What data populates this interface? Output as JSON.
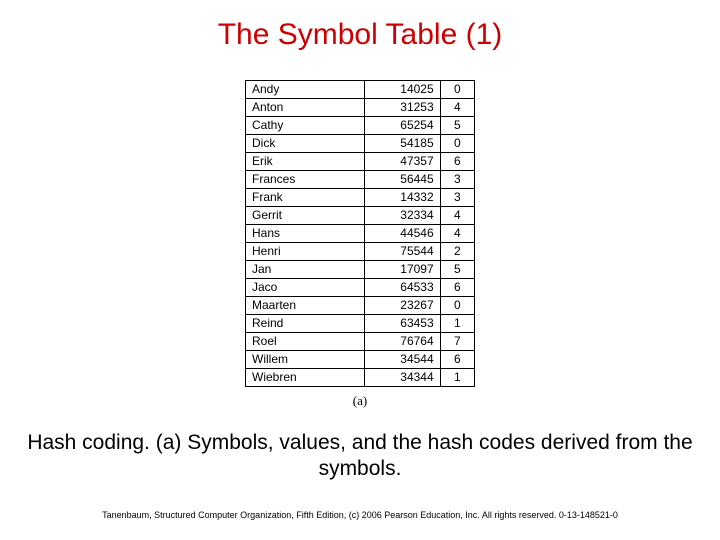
{
  "title": "The Symbol Table (1)",
  "table": {
    "rows": [
      {
        "name": "Andy",
        "value": "14025",
        "hash": "0"
      },
      {
        "name": "Anton",
        "value": "31253",
        "hash": "4"
      },
      {
        "name": "Cathy",
        "value": "65254",
        "hash": "5"
      },
      {
        "name": "Dick",
        "value": "54185",
        "hash": "0"
      },
      {
        "name": "Erik",
        "value": "47357",
        "hash": "6"
      },
      {
        "name": "Frances",
        "value": "56445",
        "hash": "3"
      },
      {
        "name": "Frank",
        "value": "14332",
        "hash": "3"
      },
      {
        "name": "Gerrit",
        "value": "32334",
        "hash": "4"
      },
      {
        "name": "Hans",
        "value": "44546",
        "hash": "4"
      },
      {
        "name": "Henri",
        "value": "75544",
        "hash": "2"
      },
      {
        "name": "Jan",
        "value": "17097",
        "hash": "5"
      },
      {
        "name": "Jaco",
        "value": "64533",
        "hash": "6"
      },
      {
        "name": "Maarten",
        "value": "23267",
        "hash": "0"
      },
      {
        "name": "Reind",
        "value": "63453",
        "hash": "1"
      },
      {
        "name": "Roel",
        "value": "76764",
        "hash": "7"
      },
      {
        "name": "Willem",
        "value": "34544",
        "hash": "6"
      },
      {
        "name": "Wiebren",
        "value": "34344",
        "hash": "1"
      }
    ],
    "sublabel": "(a)"
  },
  "caption": "Hash coding.  (a) Symbols, values, and the hash codes derived from the symbols.",
  "footer": "Tanenbaum, Structured Computer Organization, Fifth Edition, (c) 2006 Pearson Education, Inc. All rights reserved. 0-13-148521-0"
}
